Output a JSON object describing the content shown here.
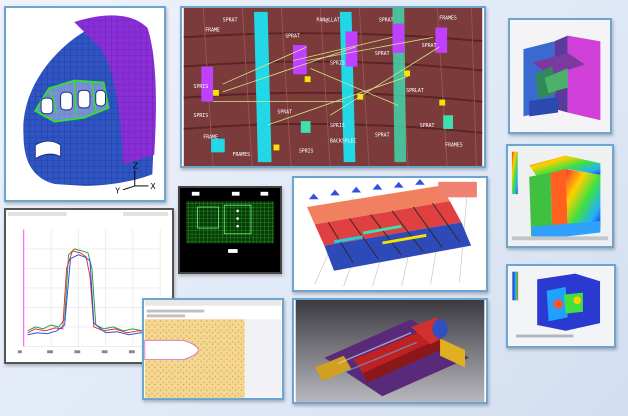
{
  "palette": {
    "frame_border": "#6ea5cf",
    "mesh_blue": "#2f55c4",
    "mesh_purple": "#8a2fd8",
    "cyan": "#22d8e6",
    "magenta": "#c040ff",
    "maroon": "#7b3b3b",
    "background": "#dfe8f6"
  },
  "composite": {
    "cockpit": {
      "axis_labels": [
        "Y",
        "Z",
        "X"
      ]
    },
    "fuselage": {
      "labels": [
        "FRAME",
        "SPRAT",
        "PAN@LLAT",
        "SPRAT",
        "FRAMES",
        "SPRIS",
        "SPRAT",
        "SPRIS",
        "SPRAT",
        "SPRAT",
        "SPRIS",
        "SPRAT",
        "SPRLAT",
        "FRAME",
        "FRAMES",
        "SPRIS",
        "SPRAT",
        "BACKSPLEC",
        "SPRIS",
        "SPRAT",
        "FRAMES"
      ]
    },
    "test_plot": {}
  }
}
